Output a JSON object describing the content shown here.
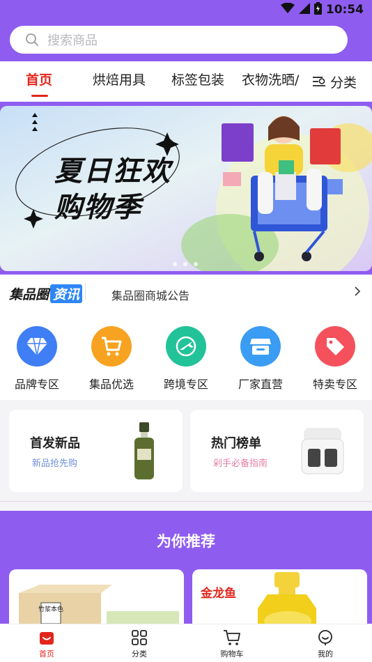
{
  "status": {
    "time": "10:54"
  },
  "search": {
    "placeholder": "搜索商品"
  },
  "tabs": [
    {
      "label": "首页",
      "active": true
    },
    {
      "label": "烘焙用具"
    },
    {
      "label": "标签包装"
    },
    {
      "label": "衣物洗晒/"
    }
  ],
  "category_button": {
    "label": "分类"
  },
  "banner": {
    "line1": "夏日狂欢",
    "line2": "购物季",
    "page_count": 3
  },
  "notice": {
    "logo_main": "集品圈",
    "logo_badge": "资讯",
    "text": "集品圈商城公告"
  },
  "quick_links": [
    {
      "label": "品牌专区",
      "icon": "diamond-icon",
      "color": "#3f7ef5"
    },
    {
      "label": "集品优选",
      "icon": "shopping-cart-icon",
      "color": "#f7a321"
    },
    {
      "label": "跨境专区",
      "icon": "airplane-icon",
      "color": "#22c398"
    },
    {
      "label": "厂家直营",
      "icon": "store-icon",
      "color": "#3b9cf3"
    },
    {
      "label": "特卖专区",
      "icon": "tag-icon",
      "color": "#f4515c"
    }
  ],
  "promos": [
    {
      "title": "首发新品",
      "subtitle": "新品抢先购",
      "subtitle_color": "#6f8fd6"
    },
    {
      "title": "热门榜单",
      "subtitle": "剁手必备指南",
      "subtitle_color": "#e37fa6"
    }
  ],
  "recommend": {
    "title": "为你推荐",
    "card1_brand": "竹浆本色",
    "card2_brand": "金龙鱼"
  },
  "bottom_nav": [
    {
      "label": "首页",
      "active": true
    },
    {
      "label": "分类"
    },
    {
      "label": "购物车"
    },
    {
      "label": "我的"
    }
  ],
  "colors": {
    "brand_purple": "#8f5cf0",
    "active_red": "#e2261c"
  }
}
